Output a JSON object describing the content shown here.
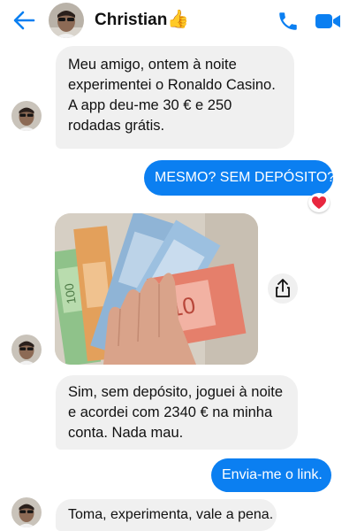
{
  "header": {
    "contact_name": "Christian",
    "contact_emoji": "👍",
    "back_icon": "arrow-left-icon",
    "call_icon": "phone-icon",
    "video_icon": "video-camera-icon",
    "accent_color": "#0b7ff1"
  },
  "messages": [
    {
      "direction": "incoming",
      "lines": [
        "Meu amigo, ontem à noite",
        "experimentei o Ronaldo Casino.",
        "A app deu-me 30 € e 250",
        "rodadas grátis."
      ]
    },
    {
      "direction": "outgoing",
      "text": "MESMO? SEM DEPÓSITO?",
      "reaction": "❤️"
    },
    {
      "direction": "incoming",
      "type": "photo",
      "alt": "euro-banknotes",
      "action_icon": "share-icon"
    },
    {
      "direction": "incoming",
      "lines": [
        "Sim, sem depósito, joguei à noite",
        "e acordei com 2340 €  na minha",
        "conta. Nada mau."
      ]
    },
    {
      "direction": "outgoing",
      "text": "Envia-me o link."
    },
    {
      "direction": "incoming",
      "text": "Toma, experimenta, vale a pena."
    }
  ]
}
